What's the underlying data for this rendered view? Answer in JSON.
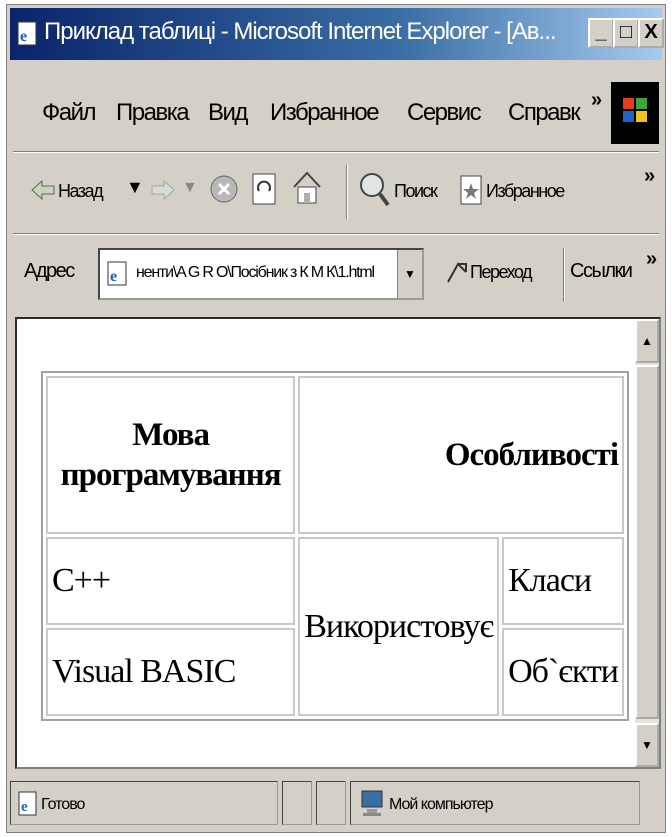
{
  "window": {
    "title": "Приклад таблиці - Microsoft Internet Explorer - [Ав...",
    "minimize_glyph": "_",
    "maximize_glyph": "□",
    "close_glyph": "X"
  },
  "menu": {
    "items": [
      "Файл",
      "Правка",
      "Вид",
      "Избранное",
      "Сервис",
      "Справк"
    ],
    "more": "»"
  },
  "toolbar": {
    "back_label": "Назад",
    "search_label": "Поиск",
    "favorites_label": "Избранное",
    "more": "»"
  },
  "address": {
    "label": "Адрес",
    "value": "ненти\\A G R O\\Посібник з К М К\\1.html",
    "go_label": "Переход",
    "links_label": "Ссылки",
    "more": "»"
  },
  "table": {
    "header_language": "Мова програмування",
    "header_features": "Особливості",
    "row1_language": "C++",
    "row2_language": "Visual BASIC",
    "uses": "Використовує",
    "classes": "Класи",
    "objects": "Об`єкти"
  },
  "status": {
    "ready": "Готово",
    "zone": "Мой компьютер"
  }
}
